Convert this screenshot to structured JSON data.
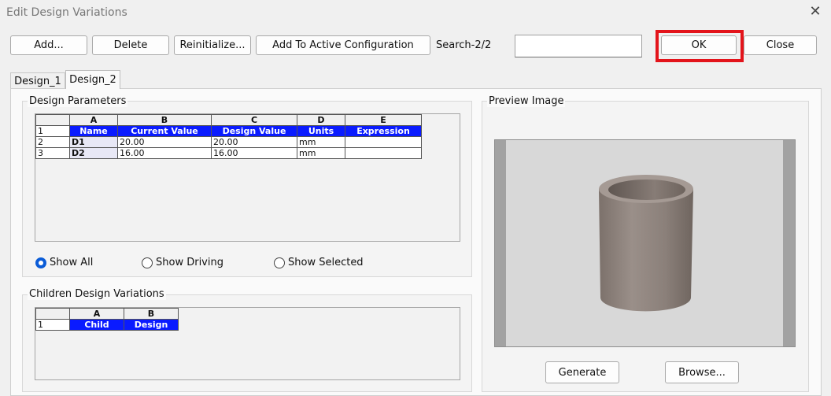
{
  "window": {
    "title": "Edit Design Variations"
  },
  "toolbar": {
    "add_label": "Add...",
    "delete_label": "Delete",
    "reinitialize_label": "Reinitialize...",
    "add_active_label": "Add To Active Configuration",
    "search_label": "Search-2/2",
    "search_value": "",
    "ok_label": "OK",
    "close_label": "Close"
  },
  "tabs": [
    {
      "label": "Design_1",
      "active": false
    },
    {
      "label": "Design_2",
      "active": true
    }
  ],
  "design_parameters": {
    "group_label": "Design Parameters",
    "columns": [
      "A",
      "B",
      "C",
      "D",
      "E"
    ],
    "row_numbers": [
      "1",
      "2",
      "3"
    ],
    "headers": [
      "Name",
      "Current Value",
      "Design Value",
      "Units",
      "Expression"
    ],
    "rows": [
      {
        "name": "D1",
        "current": "20.00",
        "design": "20.00",
        "units": "mm",
        "expression": ""
      },
      {
        "name": "D2",
        "current": "16.00",
        "design": "16.00",
        "units": "mm",
        "expression": ""
      }
    ],
    "filters": [
      {
        "label": "Show All",
        "selected": true
      },
      {
        "label": "Show Driving",
        "selected": false
      },
      {
        "label": "Show Selected",
        "selected": false
      }
    ]
  },
  "children_variations": {
    "group_label": "Children Design Variations",
    "columns": [
      "A",
      "B"
    ],
    "row_numbers": [
      "1"
    ],
    "headers": [
      "Child",
      "Design"
    ]
  },
  "preview": {
    "group_label": "Preview Image",
    "generate_label": "Generate",
    "browse_label": "Browse..."
  },
  "colors": {
    "header_blue": "#0a1bff",
    "highlight_red": "#e3141b",
    "radio_selected": "#0b5cd7",
    "model_gray": "#8a7f79"
  }
}
